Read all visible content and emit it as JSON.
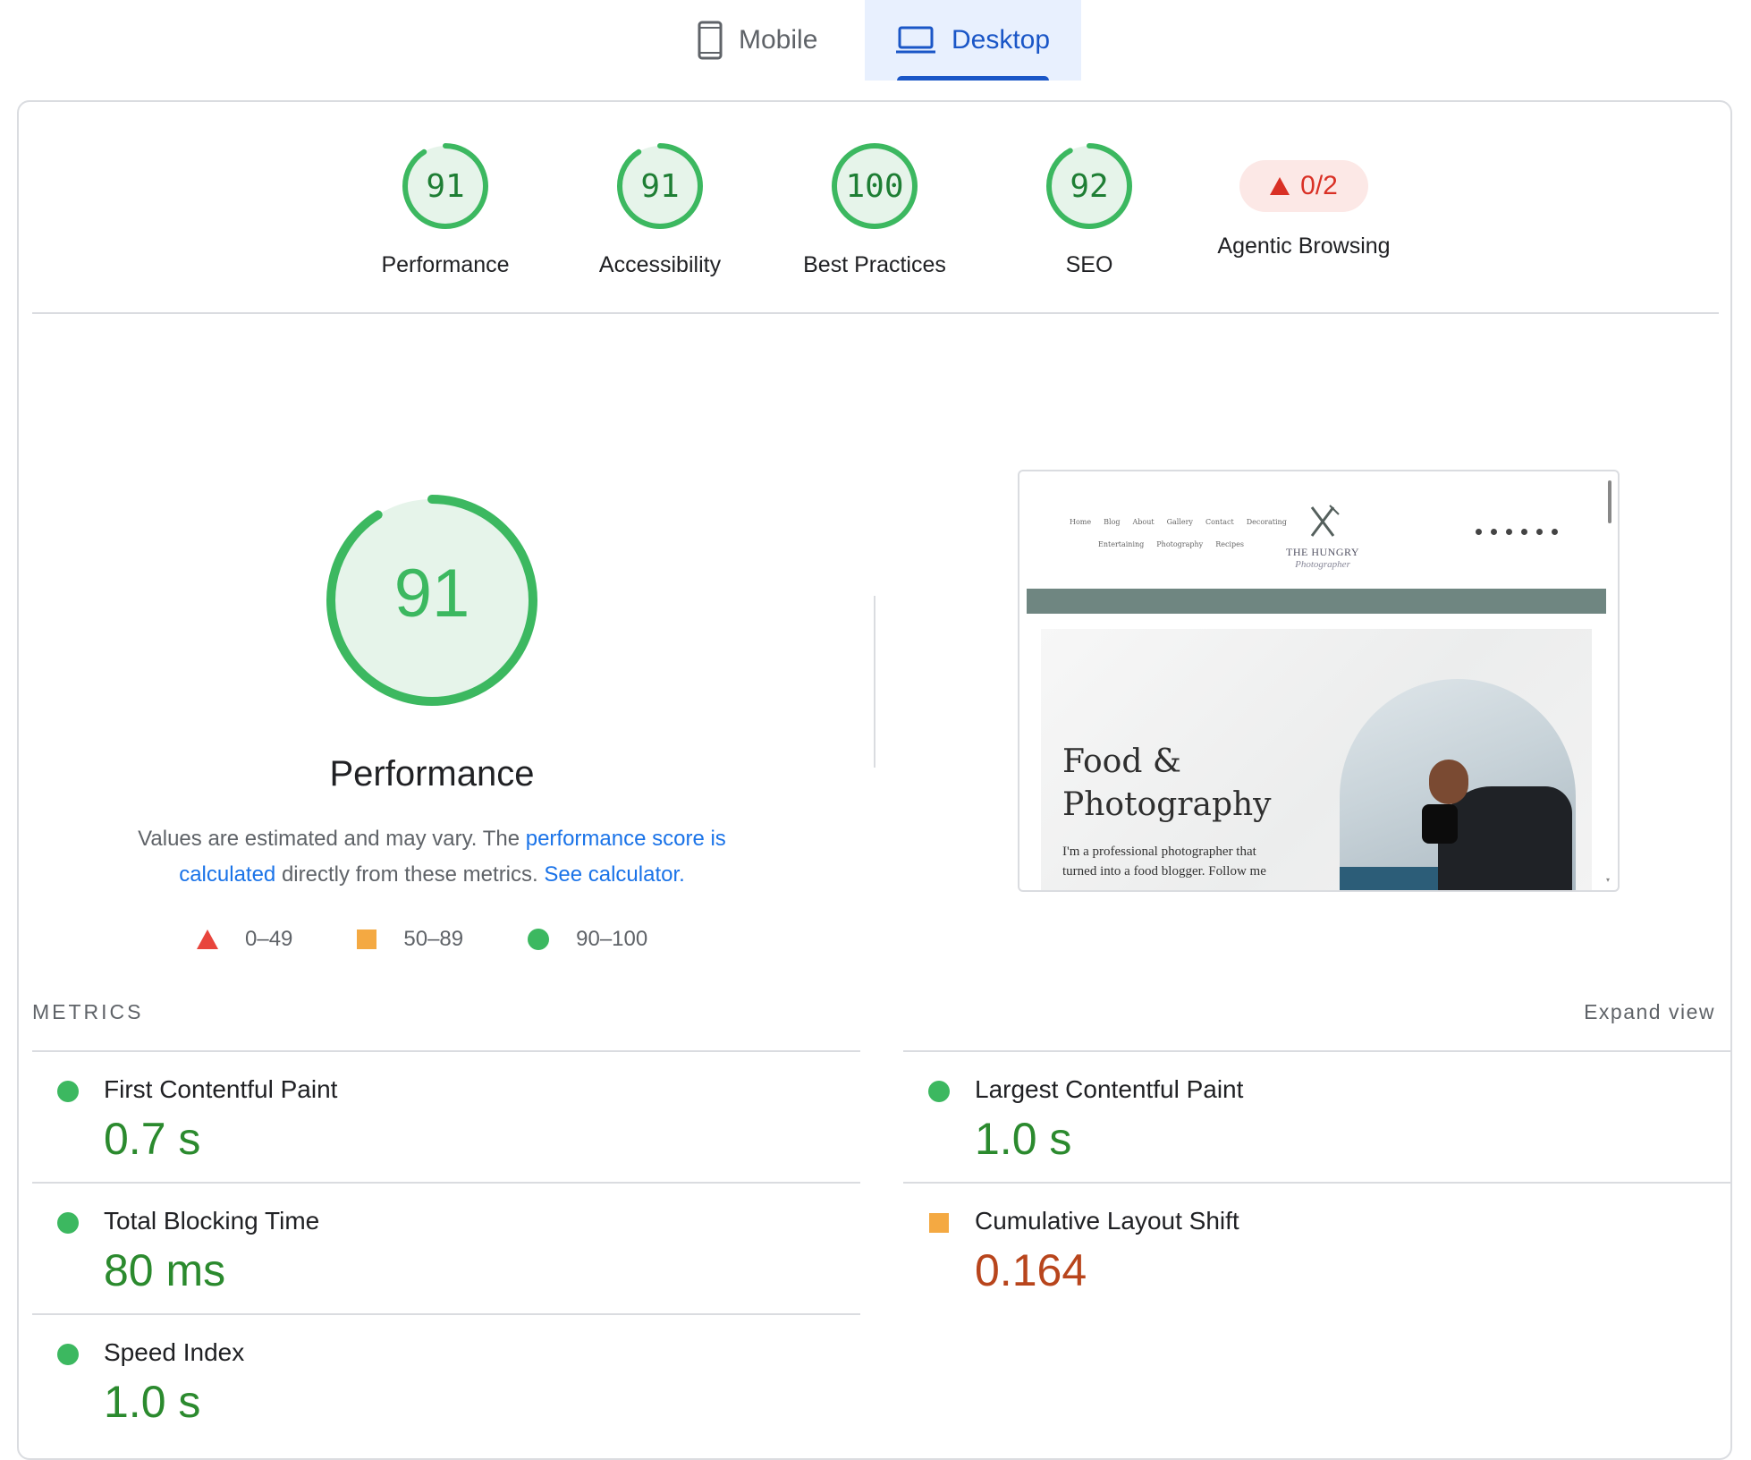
{
  "tabs": {
    "mobile": {
      "label": "Mobile",
      "icon": "phone-icon"
    },
    "desktop": {
      "label": "Desktop",
      "icon": "laptop-icon",
      "active": true
    }
  },
  "categories": [
    {
      "score": "91",
      "label": "Performance",
      "score_fraction": 0.91
    },
    {
      "score": "91",
      "label": "Accessibility",
      "score_fraction": 0.91
    },
    {
      "score": "100",
      "label": "Best Practices",
      "score_fraction": 1.0
    },
    {
      "score": "92",
      "label": "SEO",
      "score_fraction": 0.92
    },
    {
      "score": "0/2",
      "label": "Agentic Browsing",
      "status": "fail"
    }
  ],
  "performance": {
    "score": "91",
    "score_fraction": 0.91,
    "title": "Performance",
    "desc_pre": "Values are estimated and may vary. The ",
    "desc_link1": "performance score is calculated",
    "desc_mid": " directly from these metrics. ",
    "desc_link2": "See calculator."
  },
  "legend": {
    "fail": "0–49",
    "average": "50–89",
    "pass": "90–100"
  },
  "thumbnail": {
    "nav_row1": [
      "Home",
      "Blog",
      "About",
      "Gallery",
      "Contact",
      "Decorating"
    ],
    "nav_row2": [
      "Entertaining",
      "Photography",
      "Recipes"
    ],
    "brand": "THE HUNGRY",
    "brand_script": "Photographer",
    "hero_title_line1": "Food &",
    "hero_title_line2": "Photography",
    "hero_sub_line1": "I'm a professional photographer that",
    "hero_sub_line2": "turned into a food blogger. Follow me"
  },
  "metrics": {
    "heading": "METRICS",
    "expand": "Expand view",
    "items": [
      {
        "name": "First Contentful Paint",
        "value": "0.7 s",
        "rating": "pass"
      },
      {
        "name": "Largest Contentful Paint",
        "value": "1.0 s",
        "rating": "pass"
      },
      {
        "name": "Total Blocking Time",
        "value": "80 ms",
        "rating": "pass"
      },
      {
        "name": "Cumulative Layout Shift",
        "value": "0.164",
        "rating": "average"
      },
      {
        "name": "Speed Index",
        "value": "1.0 s",
        "rating": "pass"
      }
    ]
  },
  "colors": {
    "pass": "#3cb860",
    "pass_text": "#2b8a2e",
    "average": "#f4a942",
    "fail": "#e8453c",
    "link": "#1a73e8",
    "tab_active": "#1a56c7"
  }
}
